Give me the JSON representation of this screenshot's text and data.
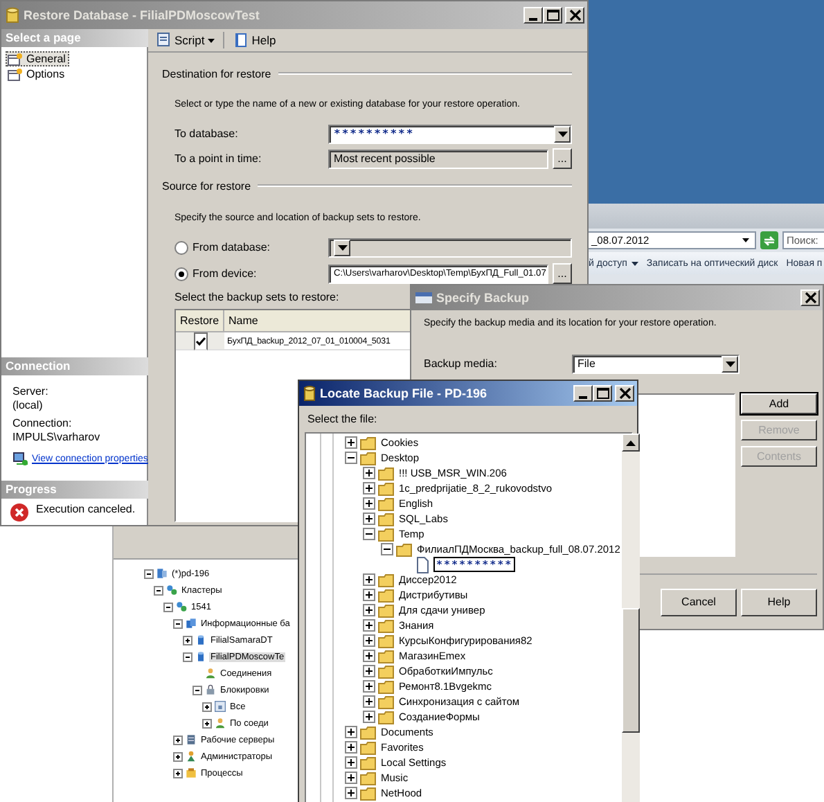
{
  "restore_window": {
    "title": "Restore Database - FilialPDMoscowTest",
    "active": false,
    "pages_header": "Select a page",
    "pages": [
      {
        "label": "General",
        "selected": true
      },
      {
        "label": "Options",
        "selected": false
      }
    ],
    "connection": {
      "header": "Connection",
      "server_label": "Server:",
      "server": "(local)",
      "connection_label": "Connection:",
      "connection": "IMPULS\\varharov",
      "link": "View connection properties"
    },
    "progress": {
      "header": "Progress",
      "message": "Execution canceled."
    },
    "toolbar": [
      {
        "label": "Script",
        "kind": "script",
        "dropdown": true
      },
      {
        "label": "Help",
        "kind": "help",
        "dropdown": false
      }
    ],
    "destination": {
      "header": "Destination for restore",
      "instruction": "Select or type the name of a new or existing database for your restore operation.",
      "to_database_label": "To database:",
      "to_database": "**********",
      "point_in_time_label": "To a point in time:",
      "point_in_time": "Most recent possible",
      "browse": "..."
    },
    "source": {
      "header": "Source for restore",
      "instruction": "Specify the source and location of backup sets to restore.",
      "options": [
        {
          "label": "From database:",
          "selected": false
        },
        {
          "label": "From device:",
          "selected": true,
          "value": "C:\\Users\\varharov\\Desktop\\Temp\\БухПД_Full_01.07",
          "browse": "..."
        }
      ],
      "sets_label": "Select the backup sets to restore:",
      "table": {
        "columns": [
          "Restore",
          "Name"
        ],
        "rows": [
          {
            "checked": true,
            "name": "БухПД_backup_2012_07_01_010004_5031"
          }
        ]
      }
    }
  },
  "explorer_window": {
    "address": "_08.07.2012",
    "search": {
      "placeholder": "Поиск:"
    },
    "toolbar": [
      {
        "label": "й доступ",
        "dropdown": true
      },
      {
        "label": "Записать на оптический диск",
        "dropdown": false
      },
      {
        "label": "Новая п",
        "dropdown": false
      }
    ]
  },
  "specify_backup": {
    "title": "Specify Backup",
    "active": false,
    "instruction": "Specify the backup media and its location for your restore operation.",
    "media_label": "Backup media:",
    "media": "File",
    "buttons": [
      {
        "label": "Add",
        "disabled": false
      },
      {
        "label": "Remove",
        "disabled": true
      },
      {
        "label": "Contents",
        "disabled": true
      }
    ],
    "footer_buttons": [
      "Cancel",
      "Help"
    ]
  },
  "locate_window": {
    "title": "Locate Backup File - PD-196",
    "active": true,
    "prompt": "Select the file:",
    "tree": [
      {
        "label": "Cookies",
        "kind": "folder",
        "expanded": false,
        "selected": false
      },
      {
        "label": "Desktop",
        "kind": "folder",
        "expanded": true,
        "selected": false,
        "children": [
          {
            "label": "!!! USB_MSR_WIN.206",
            "kind": "folder",
            "expanded": false,
            "selected": false
          },
          {
            "label": "1c_predprijatie_8_2_rukovodstvo",
            "kind": "folder",
            "expanded": false,
            "selected": false
          },
          {
            "label": "English",
            "kind": "folder",
            "expanded": false,
            "selected": false
          },
          {
            "label": "SQL_Labs",
            "kind": "folder",
            "expanded": false,
            "selected": false
          },
          {
            "label": "Temp",
            "kind": "folder",
            "expanded": true,
            "selected": false,
            "children": [
              {
                "label": "ФилиалПДМосква_backup_full_08.07.2012",
                "kind": "folder",
                "expanded": true,
                "selected": false,
                "children": [
                  {
                    "label": "**********",
                    "kind": "file",
                    "selected": true
                  }
                ]
              }
            ]
          },
          {
            "label": "Диссер2012",
            "kind": "folder",
            "expanded": false,
            "selected": false
          },
          {
            "label": "Дистрибутивы",
            "kind": "folder",
            "expanded": false,
            "selected": false
          },
          {
            "label": "Для сдачи универ",
            "kind": "folder",
            "expanded": false,
            "selected": false
          },
          {
            "label": "Знания",
            "kind": "folder",
            "expanded": false,
            "selected": false
          },
          {
            "label": "КурсыКонфигурирования82",
            "kind": "folder",
            "expanded": false,
            "selected": false
          },
          {
            "label": "МагазинEmex",
            "kind": "folder",
            "expanded": false,
            "selected": false
          },
          {
            "label": "ОбработкиИмпульс",
            "kind": "folder",
            "expanded": false,
            "selected": false
          },
          {
            "label": "Ремонт8.1Bvgekmc",
            "kind": "folder",
            "expanded": false,
            "selected": false
          },
          {
            "label": "Синхронизация с сайтом",
            "kind": "folder",
            "expanded": false,
            "selected": false
          },
          {
            "label": "СозданиеФормы",
            "kind": "folder",
            "expanded": false,
            "selected": false
          }
        ]
      },
      {
        "label": "Documents",
        "kind": "folder",
        "expanded": false,
        "selected": false
      },
      {
        "label": "Favorites",
        "kind": "folder",
        "expanded": false,
        "selected": false
      },
      {
        "label": "Local Settings",
        "kind": "folder",
        "expanded": false,
        "selected": false
      },
      {
        "label": "Music",
        "kind": "folder",
        "expanded": false,
        "selected": false
      },
      {
        "label": "NetHood",
        "kind": "folder",
        "expanded": false,
        "selected": false
      }
    ]
  },
  "console_tree": [
    {
      "label": "(*)pd-196",
      "kind": "server",
      "expanded": true,
      "selected": false,
      "children": [
        {
          "label": "Кластеры",
          "kind": "cluster",
          "expanded": true,
          "selected": false,
          "children": [
            {
              "label": "1541",
              "kind": "cluster",
              "expanded": true,
              "selected": false,
              "children": [
                {
                  "label": "Информационные ба",
                  "kind": "databases",
                  "expanded": true,
                  "selected": false,
                  "children": [
                    {
                      "label": "FilialSamaraDT",
                      "kind": "database",
                      "expanded": false,
                      "selected": false
                    },
                    {
                      "label": "FilialPDMoscowTe",
                      "kind": "database",
                      "expanded": true,
                      "selected": true,
                      "children": [
                        {
                          "label": "Соединения",
                          "kind": "users",
                          "selected": false
                        },
                        {
                          "label": "Блокировки",
                          "kind": "locks",
                          "expanded": true,
                          "selected": false,
                          "children": [
                            {
                              "label": "Все",
                              "kind": "lock",
                              "expanded": false,
                              "selected": false
                            },
                            {
                              "label": "По соеди",
                              "kind": "users",
                              "expanded": false,
                              "selected": false
                            }
                          ]
                        }
                      ]
                    }
                  ]
                },
                {
                  "label": "Рабочие серверы",
                  "kind": "servers",
                  "expanded": false,
                  "selected": false
                },
                {
                  "label": "Администраторы",
                  "kind": "admins",
                  "expanded": false,
                  "selected": false
                },
                {
                  "label": "Процессы",
                  "kind": "processes",
                  "expanded": false,
                  "selected": false
                }
              ]
            }
          ]
        }
      ]
    }
  ]
}
